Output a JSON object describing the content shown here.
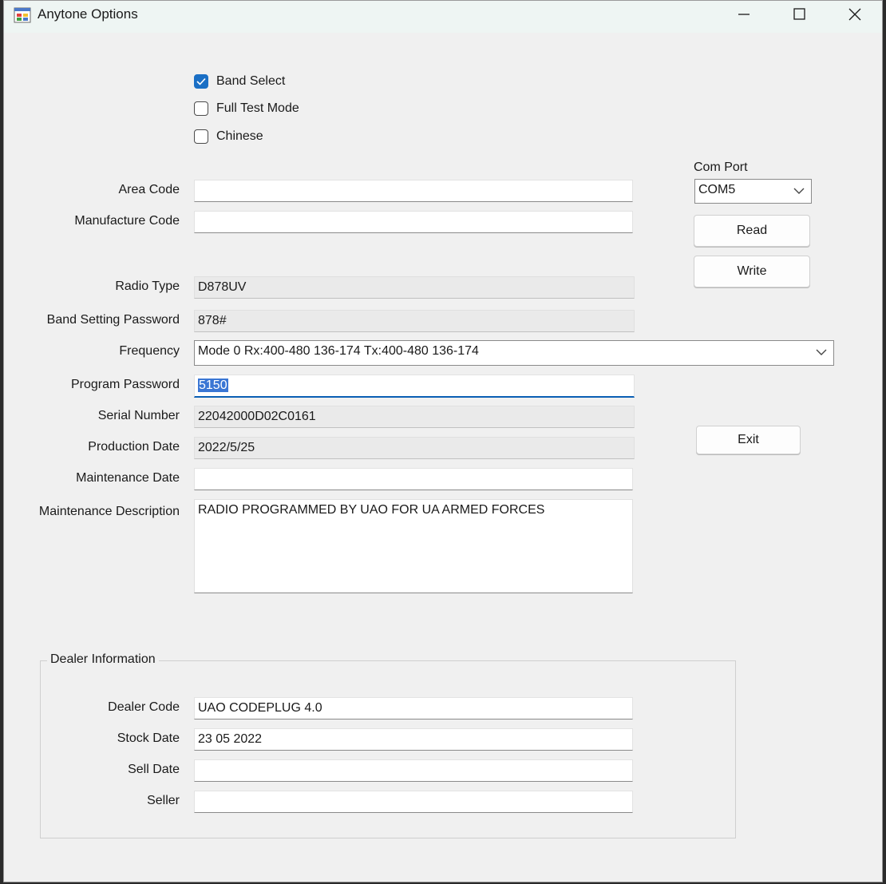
{
  "window": {
    "title": "Anytone Options",
    "icon": "windows-form-icon"
  },
  "titlebar_controls": [
    "minimize-icon",
    "maximize-icon",
    "close-icon"
  ],
  "options": [
    {
      "label": "Band Select",
      "checked": true
    },
    {
      "label": "Full Test Mode",
      "checked": false
    },
    {
      "label": "Chinese",
      "checked": false
    }
  ],
  "fields": {
    "area_code": {
      "label": "Area Code",
      "value": ""
    },
    "manufacture_code": {
      "label": "Manufacture Code",
      "value": ""
    },
    "radio_type": {
      "label": "Radio Type",
      "value": "D878UV"
    },
    "band_setting_password": {
      "label": "Band Setting Password",
      "value": "878#"
    },
    "frequency": {
      "label": "Frequency",
      "value": "Mode 0 Rx:400-480 136-174 Tx:400-480 136-174"
    },
    "program_password": {
      "label": "Program Password",
      "value": "5150"
    },
    "serial_number": {
      "label": "Serial Number",
      "value": "22042000D02C0161"
    },
    "production_date": {
      "label": "Production Date",
      "value": "2022/5/25"
    },
    "maintenance_date": {
      "label": "Maintenance Date",
      "value": ""
    },
    "maintenance_description": {
      "label": "Maintenance Description",
      "value": "RADIO PROGRAMMED BY UAO FOR UA ARMED FORCES"
    }
  },
  "com_port": {
    "label": "Com Port",
    "value": "COM5"
  },
  "buttons": {
    "read": "Read",
    "write": "Write",
    "exit": "Exit"
  },
  "dealer": {
    "title": "Dealer Information",
    "dealer_code": {
      "label": "Dealer Code",
      "value": "UAO CODEPLUG 4.0"
    },
    "stock_date": {
      "label": "Stock Date",
      "value": "23 05 2022"
    },
    "sell_date": {
      "label": "Sell Date",
      "value": ""
    },
    "seller": {
      "label": "Seller",
      "value": ""
    }
  },
  "colors": {
    "accent": "#1a6fc5",
    "selection": "#3a76d4",
    "background": "#f0f0f0"
  }
}
